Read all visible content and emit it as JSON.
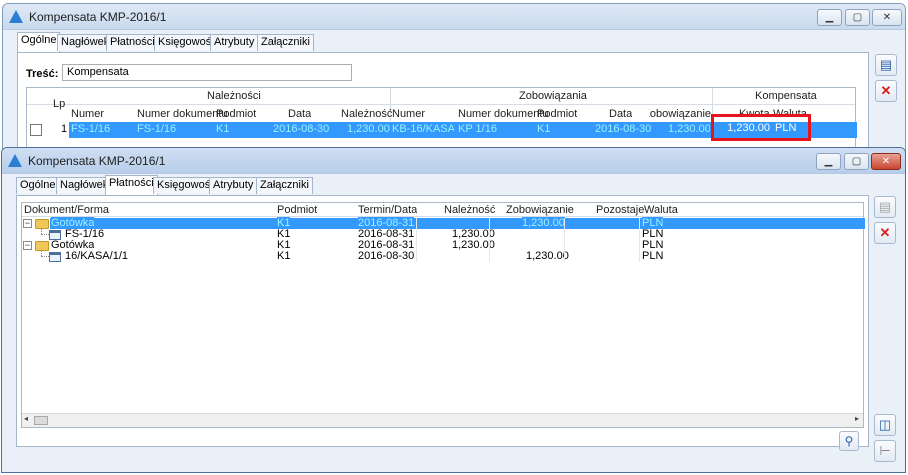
{
  "window1": {
    "title": "Kompensata KMP-2016/1",
    "tabs": [
      "Ogólne",
      "Nagłówek",
      "Płatności",
      "Księgowość",
      "Atrybuty",
      "Załączniki"
    ],
    "tresc_label": "Treść:",
    "tresc_value": "Kompensata",
    "group_headers": {
      "naleznosci": "Należności",
      "zobowiazania": "Zobowiązania",
      "kompensata": "Kompensata"
    },
    "columns": {
      "lp": "Lp",
      "numer": "Numer",
      "numer_dok": "Numer dokumentu",
      "podmiot": "Podmiot",
      "data": "Data",
      "naleznosc": "Należność",
      "numer2": "Numer",
      "numer_dok2": "Numer dokumentu",
      "podmiot2": "Podmiot",
      "data2": "Data",
      "zobowiazanie": "Zobowiązanie",
      "kwota": "Kwota",
      "waluta": "Waluta"
    },
    "row": {
      "lp": "1",
      "numer": "FS-1/16",
      "numer_dok": "FS-1/16",
      "podmiot": "K1",
      "data": "2016-08-30",
      "naleznosc": "1,230.00",
      "numer2": "KB-16/KASA/1/",
      "numer_dok2": "KP 1/16",
      "podmiot2": "K1",
      "data2": "2016-08-30",
      "zobowiazanie": "1,230.00",
      "kwota": "1,230.00",
      "waluta": "PLN"
    }
  },
  "window2": {
    "title": "Kompensata KMP-2016/1",
    "tabs": [
      "Ogólne",
      "Nagłówek",
      "Płatności",
      "Księgowość",
      "Atrybuty",
      "Załączniki"
    ],
    "columns": {
      "dokument": "Dokument/Forma",
      "podmiot": "Podmiot",
      "termin": "Termin/Data",
      "naleznosc": "Należność",
      "zobowiazanie": "Zobowiązanie",
      "pozostaje": "Pozostaje",
      "waluta": "Waluta"
    },
    "rows": [
      {
        "dokument": "Gotówka",
        "podmiot": "K1",
        "termin": "2016-08-31",
        "naleznosc": "",
        "zobowiazanie": "1,230.00",
        "pozostaje": "",
        "waluta": "PLN"
      },
      {
        "dokument": "FS-1/16",
        "podmiot": "K1",
        "termin": "2016-08-31",
        "naleznosc": "1,230.00",
        "zobowiazanie": "",
        "pozostaje": "",
        "waluta": "PLN"
      },
      {
        "dokument": "Gotówka",
        "podmiot": "K1",
        "termin": "2016-08-31",
        "naleznosc": "1,230.00",
        "zobowiazanie": "",
        "pozostaje": "",
        "waluta": "PLN"
      },
      {
        "dokument": "16/KASA/1/1",
        "podmiot": "K1",
        "termin": "2016-08-30",
        "naleznosc": "",
        "zobowiazanie": "1,230.00",
        "pozostaje": "",
        "waluta": "PLN"
      }
    ]
  },
  "colors": {
    "selection": "#3399ff",
    "selection_text": "#9af2ff",
    "highlight_box": "#e8141b"
  }
}
